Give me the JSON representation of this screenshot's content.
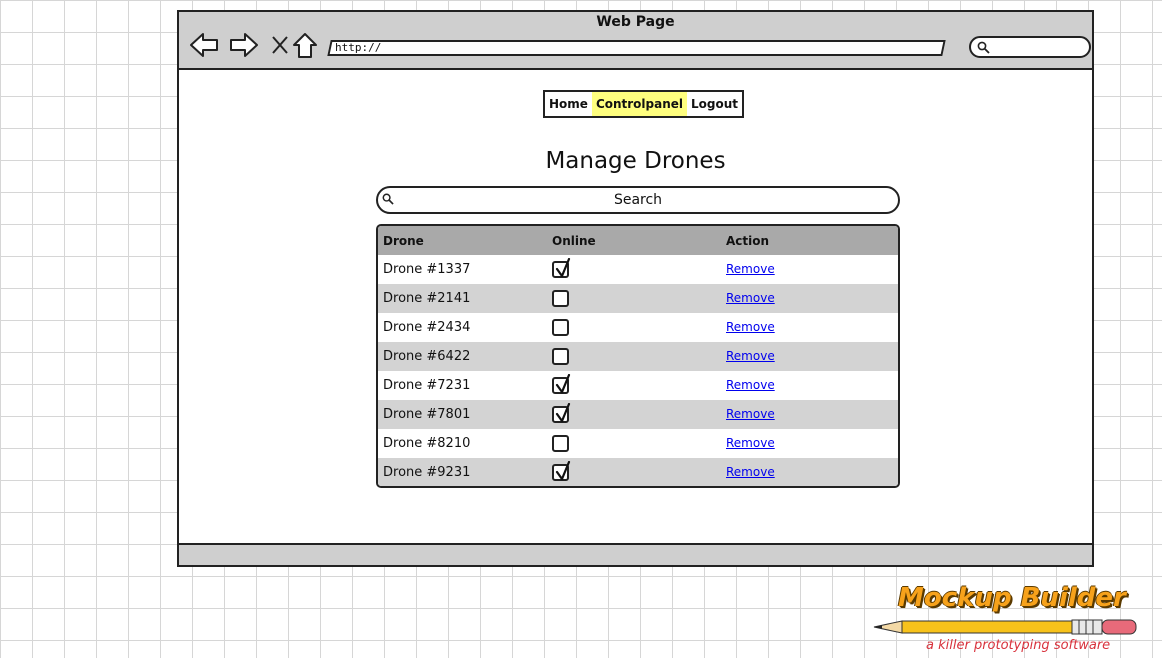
{
  "window": {
    "title": "Web Page",
    "url": "http://",
    "nav_icons": [
      "back-arrow-icon",
      "forward-arrow-icon",
      "close-icon",
      "home-icon"
    ]
  },
  "menu": {
    "items": [
      {
        "label": "Home",
        "active": false
      },
      {
        "label": "Controlpanel",
        "active": true
      },
      {
        "label": "Logout",
        "active": false
      }
    ],
    "active_color": "#ffff7f"
  },
  "page": {
    "heading": "Manage Drones",
    "search_placeholder": "Search"
  },
  "table": {
    "headers": [
      "Drone",
      "Online",
      "Action"
    ],
    "rows": [
      {
        "drone": "Drone #1337",
        "online": true,
        "action": "Remove"
      },
      {
        "drone": "Drone #2141",
        "online": false,
        "action": "Remove"
      },
      {
        "drone": "Drone #2434",
        "online": false,
        "action": "Remove"
      },
      {
        "drone": "Drone #6422",
        "online": false,
        "action": "Remove"
      },
      {
        "drone": "Drone #7231",
        "online": true,
        "action": "Remove"
      },
      {
        "drone": "Drone #7801",
        "online": true,
        "action": "Remove"
      },
      {
        "drone": "Drone #8210",
        "online": false,
        "action": "Remove"
      },
      {
        "drone": "Drone #9231",
        "online": true,
        "action": "Remove"
      }
    ],
    "header_bg": "#a9a9a9",
    "alt_row_bg": "#d3d3d3",
    "link_color": "#0000ee"
  },
  "branding": {
    "name": "Mockup Builder",
    "tagline": "a killer prototyping software",
    "accent": "#f7a21b"
  }
}
